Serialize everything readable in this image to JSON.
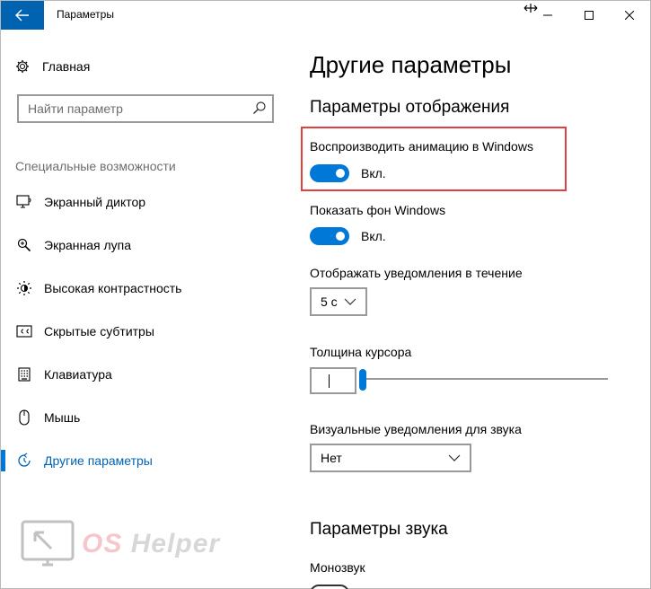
{
  "window": {
    "title": "Параметры"
  },
  "sidebar": {
    "home_label": "Главная",
    "search_placeholder": "Найти параметр",
    "section_label": "Специальные возможности",
    "items": [
      {
        "label": "Экранный диктор",
        "icon": "narrator-icon"
      },
      {
        "label": "Экранная лупа",
        "icon": "magnifier-icon"
      },
      {
        "label": "Высокая контрастность",
        "icon": "high-contrast-icon"
      },
      {
        "label": "Скрытые субтитры",
        "icon": "closed-captions-icon"
      },
      {
        "label": "Клавиатура",
        "icon": "keyboard-icon"
      },
      {
        "label": "Мышь",
        "icon": "mouse-icon"
      },
      {
        "label": "Другие параметры",
        "icon": "other-options-icon",
        "active": true
      }
    ]
  },
  "main": {
    "page_title": "Другие параметры",
    "display_section_title": "Параметры отображения",
    "animation_label": "Воспроизводить анимацию в Windows",
    "animation_state": "Вкл.",
    "animation_on": true,
    "background_label": "Показать фон Windows",
    "background_state": "Вкл.",
    "background_on": true,
    "notifications_label": "Отображать уведомления в течение",
    "notifications_value": "5 с",
    "cursor_label": "Толщина курсора",
    "cursor_thickness_level": 0.01,
    "visual_notif_label": "Визуальные уведомления для звука",
    "visual_notif_value": "Нет",
    "sound_section_title": "Параметры звука",
    "mono_label": "Монозвук"
  },
  "watermark": {
    "brand_os": "OS",
    "brand_helper": "Helper"
  },
  "colors": {
    "accent": "#0078d7",
    "back_button": "#0063b1",
    "highlight_border": "#e04040"
  }
}
